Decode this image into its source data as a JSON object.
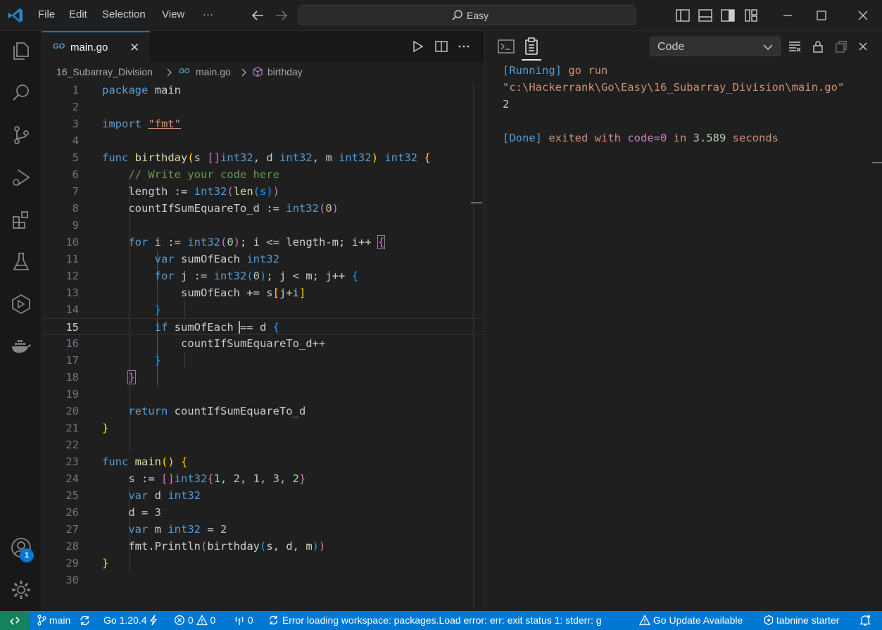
{
  "titlebar": {
    "menu": [
      "File",
      "Edit",
      "Selection",
      "View",
      "···"
    ],
    "search_label": "Easy"
  },
  "editor": {
    "tab_icon_text": "GO",
    "tab_label": "main.go",
    "tab_close": "✕",
    "breadcrumb": {
      "folder": "16_Subarray_Division",
      "file_icon_text": "GO",
      "file": "main.go",
      "symbol": "birthday"
    },
    "line_numbers": [
      "1",
      "2",
      "3",
      "4",
      "5",
      "6",
      "7",
      "8",
      "9",
      "10",
      "11",
      "12",
      "13",
      "14",
      "15",
      "16",
      "17",
      "18",
      "19",
      "20",
      "21",
      "22",
      "23",
      "24",
      "25",
      "26",
      "27",
      "28",
      "29",
      "30"
    ],
    "code": {
      "l1_kw": "package",
      "l1_name": " main",
      "l3_kw": "import",
      "l3_str": "\"fmt\"",
      "l5_kw": "func",
      "l5_fn": "birthday",
      "l5_b": "(",
      "l5_p1": "s ",
      "l5_br": "[]",
      "l5_t1": "int32",
      "l5_p2": ", d ",
      "l5_t2": "int32",
      "l5_p3": ", m ",
      "l5_t3": "int32",
      "l5_bc": ")",
      "l5_rt": "int32",
      "l5_ob": "{",
      "l6_cm": "// Write your code here",
      "l7_a": "length := ",
      "l7_t": "int32",
      "l7_b": "(",
      "l7_fn": "len",
      "l7_c": "(s)",
      "l7_d": ")",
      "l8_a": "countIfSumEquareTo_d := ",
      "l8_t": "int32",
      "l8_b": "(",
      "l8_n": "0",
      "l8_c": ")",
      "l10_kw": "for",
      "l10_a": " i := ",
      "l10_t": "int32",
      "l10_b": "(",
      "l10_n": "0",
      "l10_c": ")",
      "l10_d": "; i <= length-m; i++ ",
      "l10_ob": "{",
      "l11_kw": "var",
      "l11_a": " sumOfEach ",
      "l11_t": "int32",
      "l12_kw": "for",
      "l12_a": " j := ",
      "l12_t": "int32",
      "l12_b": "(",
      "l12_n": "0",
      "l12_c": ")",
      "l12_d": "; j < m; j++ ",
      "l12_ob": "{",
      "l13_a": "sumOfEach += s",
      "l13_b": "[",
      "l13_c": "j+i",
      "l13_d": "]",
      "l14_cb": "}",
      "l15_kw": "if",
      "l15_a": " sumOfEach == d ",
      "l15_ob": "{",
      "l16_a": "countIfSumEquareTo_d++",
      "l17_cb": "}",
      "l18_cb": "}",
      "l20_kw": "return",
      "l20_a": " countIfSumEquareTo_d",
      "l21_cb": "}",
      "l23_kw": "func",
      "l23_fn": "main",
      "l23_b": "()",
      "l23_ob": "{",
      "l24_a": "s := ",
      "l24_br": "[]",
      "l24_t": "int32",
      "l24_ob": "{",
      "l24_n": "1, 2, 1, 3, 2",
      "l24_cb": "}",
      "l25_kw": "var",
      "l25_a": " d ",
      "l25_t": "int32",
      "l26_a": "d = ",
      "l26_n": "3",
      "l27_kw": "var",
      "l27_a": " m ",
      "l27_t": "int32",
      "l27_b": " = ",
      "l27_n": "2",
      "l28_pk": "fmt",
      "l28_a": ".",
      "l28_fn": "Println",
      "l28_b": "(",
      "l28_fn2": "birthday",
      "l28_c": "(",
      "l28_d": "s, d, m",
      "l28_e": ")",
      "l28_f": ")",
      "l29_cb": "}"
    }
  },
  "panel": {
    "channel": "Code",
    "output": {
      "running_tag": "[Running]",
      "running_cmd": " go run",
      "path": "\"c:\\Hackerrank\\Go\\Easy\\16_Subarray_Division\\main.go\"",
      "result": "2",
      "done_tag": "[Done]",
      "done_a": " exited with ",
      "done_code": "code=0",
      "done_in": " in ",
      "done_time": "3.589",
      "done_unit": " seconds"
    }
  },
  "statusbar": {
    "branch": "main",
    "go_version": "Go 1.20.4",
    "errors": "0",
    "warnings": "0",
    "ports": "0",
    "message": "Error loading workspace: packages.Load error: err: exit status 1: stderr: g",
    "go_update": "Go Update Available",
    "tabnine": "tabnine starter"
  },
  "colors": {
    "accent": "#0078d4",
    "remote": "#16825d"
  }
}
